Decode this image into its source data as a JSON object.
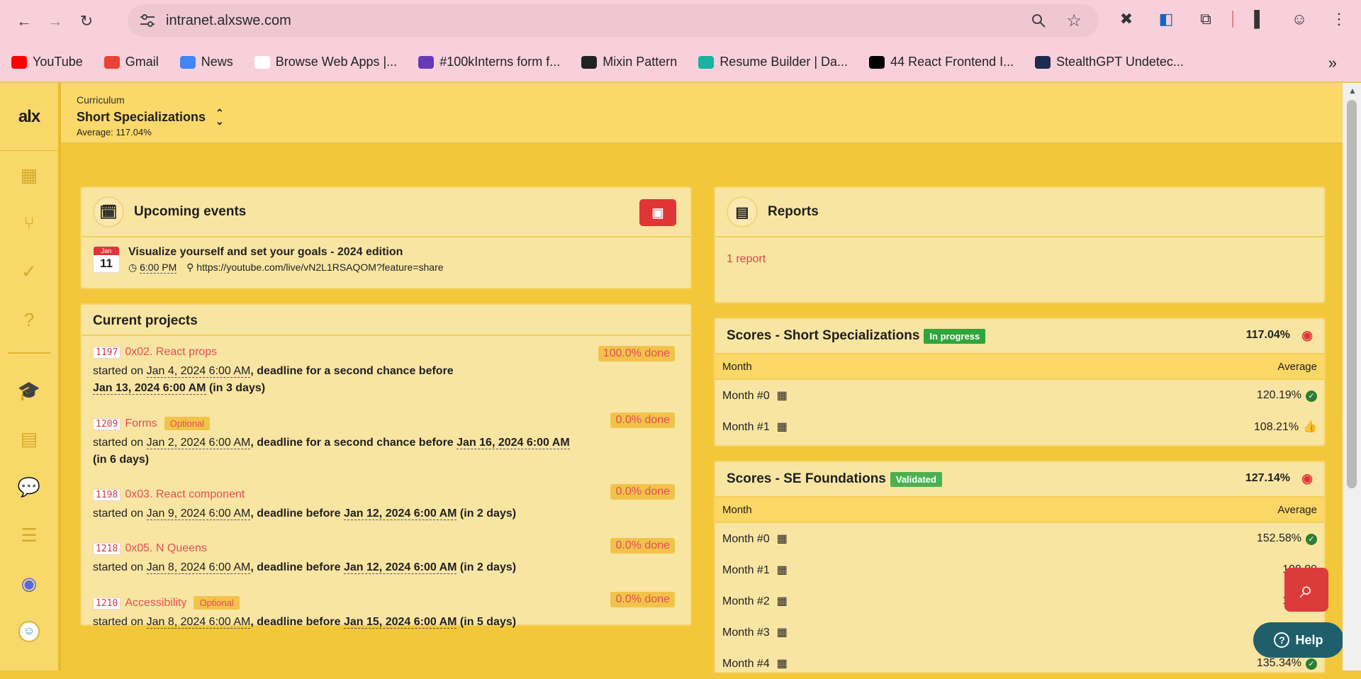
{
  "browser": {
    "url": "intranet.alxswe.com",
    "bookmarks": [
      {
        "label": "YouTube",
        "icon": "youtube-icon",
        "color": "#ff0000"
      },
      {
        "label": "Gmail",
        "icon": "gmail-icon",
        "color": "#ea4335"
      },
      {
        "label": "News",
        "icon": "news-icon",
        "color": "#4285f4"
      },
      {
        "label": "Browse Web Apps |...",
        "icon": "webapps-icon",
        "color": "#ffffff"
      },
      {
        "label": "#100kInterns form f...",
        "icon": "form-icon",
        "color": "#673ab7"
      },
      {
        "label": "Mixin Pattern",
        "icon": "globe-icon",
        "color": "#222222"
      },
      {
        "label": "Resume Builder | Da...",
        "icon": "resume-icon",
        "color": "#18b29f"
      },
      {
        "label": "44 React Frontend I...",
        "icon": "dev-icon",
        "color": "#000000"
      },
      {
        "label": "StealthGPT Undetec...",
        "icon": "stealth-icon",
        "color": "#1f2b4f"
      }
    ]
  },
  "app": {
    "logo": "alx",
    "header": {
      "small": "Curriculum",
      "title": "Short Specializations",
      "average_label": "Average: ",
      "average_value": "117.04%"
    }
  },
  "events": {
    "title": "Upcoming events",
    "items": [
      {
        "month": "Jan",
        "day": "11",
        "title": "Visualize yourself and set your goals - 2024 edition",
        "time": "6:00 PM",
        "location": "https://youtube.com/live/vN2L1RSAQOM?feature=share"
      }
    ]
  },
  "reports": {
    "title": "Reports",
    "link": "1 report"
  },
  "projects": {
    "title": "Current projects",
    "items": [
      {
        "id": "1197",
        "name": "0x02. React props",
        "tag": "",
        "done": "100.0% done",
        "l1a": "started on ",
        "start": "Jan 4, 2024 6:00 AM",
        "l1b": ", deadline for a second chance before",
        "deadline": "Jan 13, 2024 6:00 AM",
        "rel": " (in 3 days)"
      },
      {
        "id": "1209",
        "name": "Forms",
        "tag": "Optional",
        "done": "0.0% done",
        "l1a": "started on ",
        "start": "Jan 2, 2024 6:00 AM",
        "l1b": ", deadline for a second chance before ",
        "deadline": "Jan 16, 2024 6:00 AM",
        "rel": "(in 6 days)"
      },
      {
        "id": "1198",
        "name": "0x03. React component",
        "tag": "",
        "done": "0.0% done",
        "l1a": "started on ",
        "start": "Jan 9, 2024 6:00 AM",
        "l1b": ", deadline before ",
        "deadline": "Jan 12, 2024 6:00 AM",
        "rel": " (in 2 days)"
      },
      {
        "id": "1218",
        "name": "0x05. N Queens",
        "tag": "",
        "done": "0.0% done",
        "l1a": "started on ",
        "start": "Jan 8, 2024 6:00 AM",
        "l1b": ", deadline before ",
        "deadline": "Jan 12, 2024 6:00 AM",
        "rel": " (in 2 days)"
      },
      {
        "id": "1210",
        "name": "Accessibility",
        "tag": "Optional",
        "done": "0.0% done",
        "l1a": "started on ",
        "start": "Jan 8, 2024 6:00 AM",
        "l1b": ", deadline before ",
        "deadline": "Jan 15, 2024 6:00 AM",
        "rel": " (in 5 days)"
      }
    ]
  },
  "scores": [
    {
      "title": "Scores - Short Specializations",
      "badge": "In progress",
      "badge_color": "#2fa53a",
      "score": "117.04%",
      "col_month": "Month",
      "col_avg": "Average",
      "rows": [
        {
          "month": "Month #0",
          "avg": "120.19%",
          "status": "check"
        },
        {
          "month": "Month #1",
          "avg": "108.21%",
          "status": "thumb"
        }
      ]
    },
    {
      "title": "Scores - SE Foundations",
      "badge": "Validated",
      "badge_color": "#4caf50",
      "score": "127.14%",
      "col_month": "Month",
      "col_avg": "Average",
      "rows": [
        {
          "month": "Month #0",
          "avg": "152.58%",
          "status": "check"
        },
        {
          "month": "Month #1",
          "avg": "108.89",
          "status": "none"
        },
        {
          "month": "Month #2",
          "avg": "108.46",
          "status": "none"
        },
        {
          "month": "Month #3",
          "avg": "1",
          "status": "none"
        },
        {
          "month": "Month #4",
          "avg": "135.34%",
          "status": "check"
        }
      ]
    }
  ],
  "widgets": {
    "help": "Help"
  }
}
